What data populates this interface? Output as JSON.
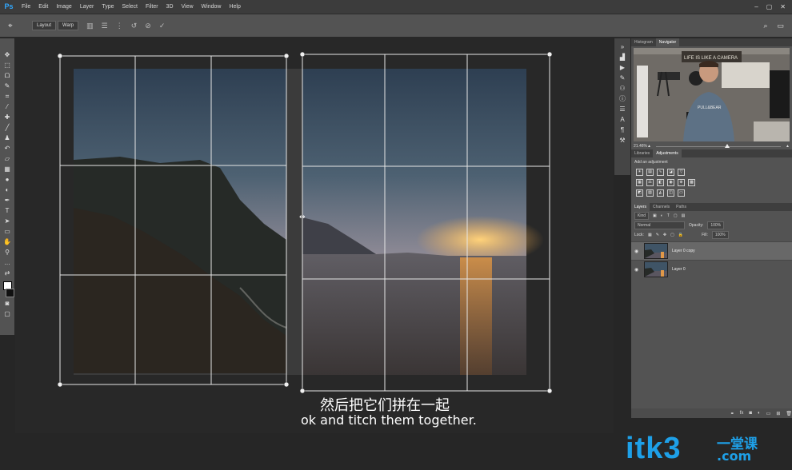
{
  "app": {
    "logo": "Ps"
  },
  "menu": [
    "File",
    "Edit",
    "Image",
    "Layer",
    "Type",
    "Select",
    "Filter",
    "3D",
    "View",
    "Window",
    "Help"
  ],
  "window_controls": [
    "–",
    "▢",
    "✕"
  ],
  "options": {
    "layout_label": "Layout",
    "warp_label": "Warp"
  },
  "panels": {
    "top_tabs": [
      "Histogram",
      "Navigator"
    ],
    "zoom": "21.46%",
    "thumb_sign": "LIFE IS LIKE A CAMERA",
    "mid_tabs": [
      "Libraries",
      "Adjustments"
    ],
    "adjustments_title": "Add an adjustment",
    "layers_tabs": [
      "Layers",
      "Channels",
      "Paths"
    ],
    "kind_label": "Kind",
    "blend_mode": "Normal",
    "opacity_label": "Opacity:",
    "opacity_value": "100%",
    "lock_label": "Lock:",
    "fill_label": "Fill:",
    "fill_value": "100%",
    "layers": [
      {
        "name": "Layer 0 copy",
        "selected": true
      },
      {
        "name": "Layer 0",
        "selected": false
      }
    ]
  },
  "subtitles": {
    "cn": "然后把它们拼在一起",
    "en": "ok and titch them together."
  },
  "watermark": {
    "text": "itk3",
    "cn": "一堂课",
    "domain": ".com"
  },
  "colors": {
    "accent": "#31a8ff",
    "watermark": "#1ea0e8"
  }
}
